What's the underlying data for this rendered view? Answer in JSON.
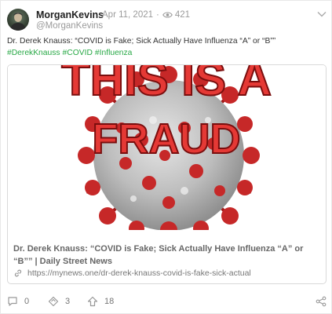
{
  "post": {
    "username": "MorganKevins",
    "date": "Apr 11, 2021",
    "separator": "·",
    "views": "421",
    "handle": "@MorganKevins",
    "text": "Dr. Derek Knauss: “COVID is Fake; Sick Actually Have Influenza “A” or “B””",
    "hashtags": [
      "#DerekKnauss",
      "#COVID",
      "#Influenza"
    ]
  },
  "link_card": {
    "image_text_line1": "THIS IS A",
    "image_text_line2": "FRAUD",
    "title": "Dr. Derek Knauss: “COVID is Fake; Sick Actually Have Influenza “A” or “B”” | Daily Street News",
    "url": "https://mynews.one/dr-derek-knauss-covid-is-fake-sick-actual"
  },
  "actions": {
    "comments": "0",
    "reposts": "3",
    "upvotes": "18"
  },
  "icons": {
    "views": "eye-icon",
    "menu": "chevron-down-icon",
    "comment": "comment-icon",
    "repost": "repost-icon",
    "upvote": "upvote-icon",
    "share": "share-icon",
    "link": "link-icon"
  },
  "colors": {
    "hashtag": "#27a845",
    "virus_red": "#c62828",
    "image_text_red": "#e53935"
  }
}
